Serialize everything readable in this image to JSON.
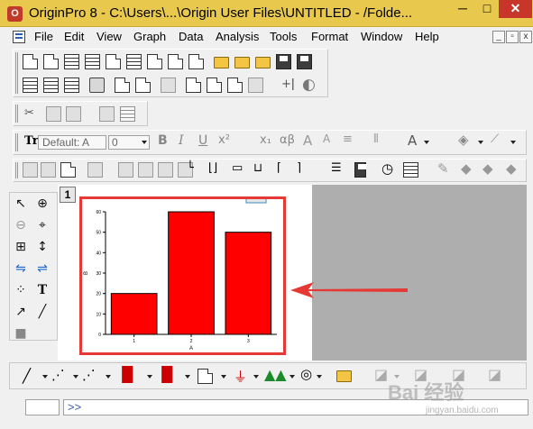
{
  "window": {
    "title": "OriginPro 8 - C:\\Users\\...\\Origin User Files\\UNTITLED - /Folde...",
    "min_label": "─",
    "max_label": "□",
    "close_label": "✕"
  },
  "menu": {
    "items": [
      {
        "label": "File"
      },
      {
        "label": "Edit"
      },
      {
        "label": "View"
      },
      {
        "label": "Graph"
      },
      {
        "label": "Data"
      },
      {
        "label": "Analysis"
      },
      {
        "label": "Tools"
      },
      {
        "label": "Format"
      },
      {
        "label": "Window"
      },
      {
        "label": "Help"
      }
    ],
    "mdi_min": "_",
    "mdi_restore": "▫",
    "mdi_close": "x"
  },
  "format_toolbar": {
    "font_value": "Default: A",
    "size_value": "0",
    "bold": "B",
    "italic": "I",
    "underline": "U",
    "superscript": "x²",
    "subscript": "x₁",
    "greek": "αβ"
  },
  "graph": {
    "layer_label": "1",
    "accent_color": "#e53935",
    "bar_color": "#ff0000"
  },
  "chart_data": {
    "type": "bar",
    "categories": [
      "1",
      "2",
      "3"
    ],
    "values": [
      20,
      60,
      50
    ],
    "xlabel": "A",
    "ylabel": "B",
    "ylim": [
      0,
      60
    ],
    "yticks": [
      "0",
      "10",
      "20",
      "30",
      "40",
      "50",
      "60"
    ]
  },
  "command": {
    "prompt": ">>"
  },
  "watermark": {
    "main": "Bai 经验",
    "sub": "jingyan.baidu.com"
  }
}
